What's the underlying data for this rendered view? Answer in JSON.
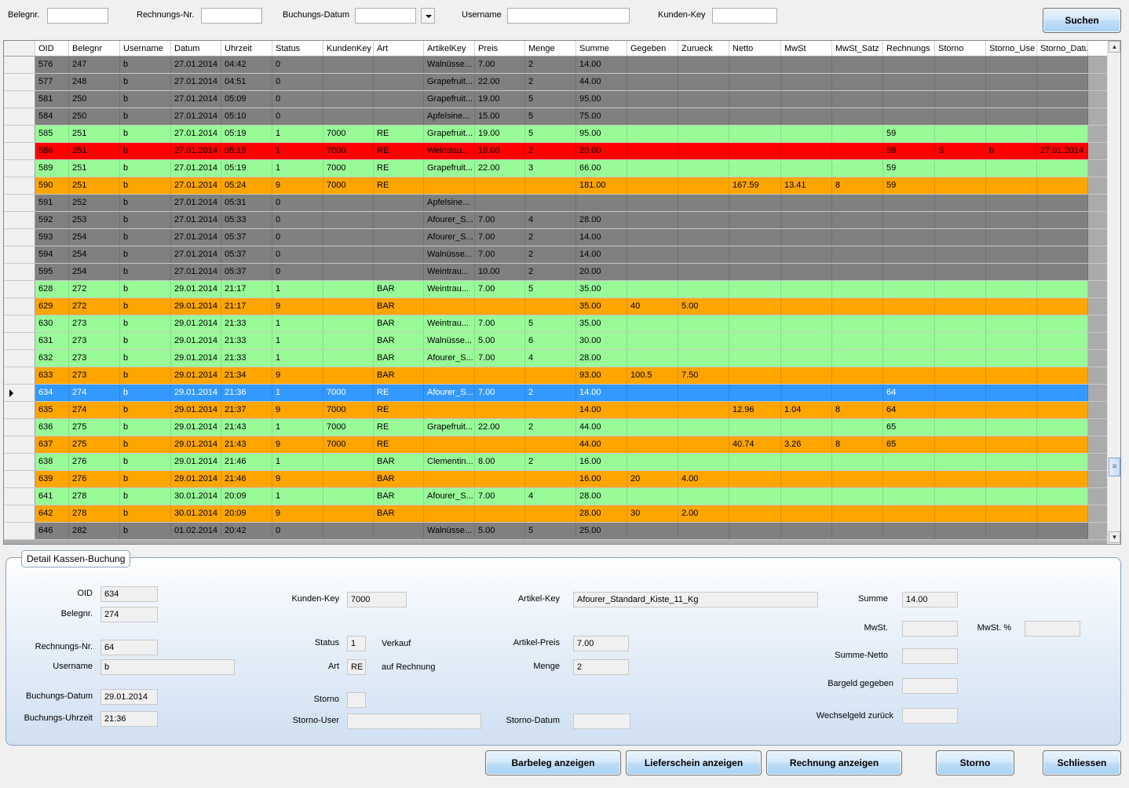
{
  "search": {
    "belegnr_label": "Belegnr.",
    "belegnr_value": "",
    "rechnungsnr_label": "Rechnungs-Nr.",
    "rechnungsnr_value": "",
    "buchungsdatum_label": "Buchungs-Datum",
    "buchungsdatum_value": "",
    "username_label": "Username",
    "username_value": "",
    "kundenkey_label": "Kunden-Key",
    "kundenkey_value": "",
    "search_button": "Suchen"
  },
  "grid": {
    "columns": [
      "OID",
      "Belegnr",
      "Username",
      "Datum",
      "Uhrzeit",
      "Status",
      "KundenKey",
      "Art",
      "ArtikelKey",
      "Preis",
      "Menge",
      "Summe",
      "Gegeben",
      "Zurueck",
      "Netto",
      "MwSt",
      "MwSt_Satz",
      "Rechnungs",
      "Storno",
      "Storno_Use",
      "Storno_Datu"
    ],
    "status_colors": {
      "gray": "#808080",
      "green": "#98fb98",
      "red": "#ff0000",
      "orange": "#ffa500",
      "selected": "#3399ff"
    },
    "rows": [
      {
        "style": "gray",
        "cells": [
          "576",
          "247",
          "b",
          "27.01.2014",
          "04:42",
          "0",
          "",
          "",
          "Walnüsse...",
          "7.00",
          "2",
          "14.00",
          "",
          "",
          "",
          "",
          "",
          "",
          "",
          "",
          ""
        ]
      },
      {
        "style": "gray",
        "cells": [
          "577",
          "248",
          "b",
          "27.01.2014",
          "04:51",
          "0",
          "",
          "",
          "Grapefruit...",
          "22.00",
          "2",
          "44.00",
          "",
          "",
          "",
          "",
          "",
          "",
          "",
          "",
          ""
        ]
      },
      {
        "style": "gray",
        "cells": [
          "581",
          "250",
          "b",
          "27.01.2014",
          "05:09",
          "0",
          "",
          "",
          "Grapefruit...",
          "19.00",
          "5",
          "95.00",
          "",
          "",
          "",
          "",
          "",
          "",
          "",
          "",
          ""
        ]
      },
      {
        "style": "gray",
        "cells": [
          "584",
          "250",
          "b",
          "27.01.2014",
          "05:10",
          "0",
          "",
          "",
          "Apfelsine...",
          "15.00",
          "5",
          "75.00",
          "",
          "",
          "",
          "",
          "",
          "",
          "",
          "",
          ""
        ]
      },
      {
        "style": "green",
        "cells": [
          "585",
          "251",
          "b",
          "27.01.2014",
          "05:19",
          "1",
          "7000",
          "RE",
          "Grapefruit...",
          "19.00",
          "5",
          "95.00",
          "",
          "",
          "",
          "",
          "",
          "59",
          "",
          "",
          ""
        ]
      },
      {
        "style": "red",
        "cells": [
          "586",
          "251",
          "b",
          "27.01.2014",
          "05:19",
          "1",
          "7000",
          "RE",
          "Weintrau...",
          "10.00",
          "2",
          "20.00",
          "",
          "",
          "",
          "",
          "",
          "59",
          "S",
          "b",
          "27.01.2014"
        ]
      },
      {
        "style": "green",
        "cells": [
          "589",
          "251",
          "b",
          "27.01.2014",
          "05:19",
          "1",
          "7000",
          "RE",
          "Grapefruit...",
          "22.00",
          "3",
          "66.00",
          "",
          "",
          "",
          "",
          "",
          "59",
          "",
          "",
          ""
        ]
      },
      {
        "style": "orange",
        "cells": [
          "590",
          "251",
          "b",
          "27.01.2014",
          "05:24",
          "9",
          "7000",
          "RE",
          "",
          "",
          "",
          "181.00",
          "",
          "",
          "167.59",
          "13.41",
          "8",
          "59",
          "",
          "",
          ""
        ]
      },
      {
        "style": "gray",
        "cells": [
          "591",
          "252",
          "b",
          "27.01.2014",
          "05:31",
          "0",
          "",
          "",
          "Apfelsine...",
          "",
          "",
          "",
          "",
          "",
          "",
          "",
          "",
          "",
          "",
          "",
          ""
        ]
      },
      {
        "style": "gray",
        "cells": [
          "592",
          "253",
          "b",
          "27.01.2014",
          "05:33",
          "0",
          "",
          "",
          "Afourer_S...",
          "7.00",
          "4",
          "28.00",
          "",
          "",
          "",
          "",
          "",
          "",
          "",
          "",
          ""
        ]
      },
      {
        "style": "gray",
        "cells": [
          "593",
          "254",
          "b",
          "27.01.2014",
          "05:37",
          "0",
          "",
          "",
          "Afourer_S...",
          "7.00",
          "2",
          "14.00",
          "",
          "",
          "",
          "",
          "",
          "",
          "",
          "",
          ""
        ]
      },
      {
        "style": "gray",
        "cells": [
          "594",
          "254",
          "b",
          "27.01.2014",
          "05:37",
          "0",
          "",
          "",
          "Walnüsse...",
          "7.00",
          "2",
          "14.00",
          "",
          "",
          "",
          "",
          "",
          "",
          "",
          "",
          ""
        ]
      },
      {
        "style": "gray",
        "cells": [
          "595",
          "254",
          "b",
          "27.01.2014",
          "05:37",
          "0",
          "",
          "",
          "Weintrau...",
          "10.00",
          "2",
          "20.00",
          "",
          "",
          "",
          "",
          "",
          "",
          "",
          "",
          ""
        ]
      },
      {
        "style": "green",
        "cells": [
          "628",
          "272",
          "b",
          "29.01.2014",
          "21:17",
          "1",
          "",
          "BAR",
          "Weintrau...",
          "7.00",
          "5",
          "35.00",
          "",
          "",
          "",
          "",
          "",
          "",
          "",
          "",
          ""
        ]
      },
      {
        "style": "orange",
        "cells": [
          "629",
          "272",
          "b",
          "29.01.2014",
          "21:17",
          "9",
          "",
          "BAR",
          "",
          "",
          "",
          "35.00",
          "40",
          "5.00",
          "",
          "",
          "",
          "",
          "",
          "",
          ""
        ]
      },
      {
        "style": "green",
        "cells": [
          "630",
          "273",
          "b",
          "29.01.2014",
          "21:33",
          "1",
          "",
          "BAR",
          "Weintrau...",
          "7.00",
          "5",
          "35.00",
          "",
          "",
          "",
          "",
          "",
          "",
          "",
          "",
          ""
        ]
      },
      {
        "style": "green",
        "cells": [
          "631",
          "273",
          "b",
          "29.01.2014",
          "21:33",
          "1",
          "",
          "BAR",
          "Walnüsse...",
          "5.00",
          "6",
          "30.00",
          "",
          "",
          "",
          "",
          "",
          "",
          "",
          "",
          ""
        ]
      },
      {
        "style": "green",
        "cells": [
          "632",
          "273",
          "b",
          "29.01.2014",
          "21:33",
          "1",
          "",
          "BAR",
          "Afourer_S...",
          "7.00",
          "4",
          "28.00",
          "",
          "",
          "",
          "",
          "",
          "",
          "",
          "",
          ""
        ]
      },
      {
        "style": "orange",
        "cells": [
          "633",
          "273",
          "b",
          "29.01.2014",
          "21:34",
          "9",
          "",
          "BAR",
          "",
          "",
          "",
          "93.00",
          "100.5",
          "7.50",
          "",
          "",
          "",
          "",
          "",
          "",
          ""
        ]
      },
      {
        "style": "blue",
        "current": true,
        "cells": [
          "634",
          "274",
          "b",
          "29.01.2014",
          "21:36",
          "1",
          "7000",
          "RE",
          "Afourer_S...",
          "7.00",
          "2",
          "14.00",
          "",
          "",
          "",
          "",
          "",
          "64",
          "",
          "",
          ""
        ]
      },
      {
        "style": "orange",
        "cells": [
          "635",
          "274",
          "b",
          "29.01.2014",
          "21:37",
          "9",
          "7000",
          "RE",
          "",
          "",
          "",
          "14.00",
          "",
          "",
          "12.96",
          "1.04",
          "8",
          "64",
          "",
          "",
          ""
        ]
      },
      {
        "style": "green",
        "cells": [
          "636",
          "275",
          "b",
          "29.01.2014",
          "21:43",
          "1",
          "7000",
          "RE",
          "Grapefruit...",
          "22.00",
          "2",
          "44.00",
          "",
          "",
          "",
          "",
          "",
          "65",
          "",
          "",
          ""
        ]
      },
      {
        "style": "orange",
        "cells": [
          "637",
          "275",
          "b",
          "29.01.2014",
          "21:43",
          "9",
          "7000",
          "RE",
          "",
          "",
          "",
          "44.00",
          "",
          "",
          "40.74",
          "3.26",
          "8",
          "65",
          "",
          "",
          ""
        ]
      },
      {
        "style": "green",
        "cells": [
          "638",
          "276",
          "b",
          "29.01.2014",
          "21:46",
          "1",
          "",
          "BAR",
          "Clementin...",
          "8.00",
          "2",
          "16.00",
          "",
          "",
          "",
          "",
          "",
          "",
          "",
          "",
          ""
        ]
      },
      {
        "style": "orange",
        "cells": [
          "639",
          "276",
          "b",
          "29.01.2014",
          "21:46",
          "9",
          "",
          "BAR",
          "",
          "",
          "",
          "16.00",
          "20",
          "4.00",
          "",
          "",
          "",
          "",
          "",
          "",
          ""
        ]
      },
      {
        "style": "green",
        "cells": [
          "641",
          "278",
          "b",
          "30.01.2014",
          "20:09",
          "1",
          "",
          "BAR",
          "Afourer_S...",
          "7.00",
          "4",
          "28.00",
          "",
          "",
          "",
          "",
          "",
          "",
          "",
          "",
          ""
        ]
      },
      {
        "style": "orange",
        "cells": [
          "642",
          "278",
          "b",
          "30.01.2014",
          "20:09",
          "9",
          "",
          "BAR",
          "",
          "",
          "",
          "28.00",
          "30",
          "2.00",
          "",
          "",
          "",
          "",
          "",
          "",
          ""
        ]
      },
      {
        "style": "gray",
        "cells": [
          "646",
          "282",
          "b",
          "01.02.2014",
          "20:42",
          "0",
          "",
          "",
          "Walnüsse...",
          "5.00",
          "5",
          "25.00",
          "",
          "",
          "",
          "",
          "",
          "",
          "",
          "",
          ""
        ]
      }
    ]
  },
  "detail": {
    "title": "Detail Kassen-Buchung",
    "oid_label": "OID",
    "oid_value": "634",
    "belegnr_label": "Belegnr.",
    "belegnr_value": "274",
    "rechnungsnr_label": "Rechnungs-Nr.",
    "rechnungsnr_value": "64",
    "username_label": "Username",
    "username_value": "b",
    "buchungsdatum_label": "Buchungs-Datum",
    "buchungsdatum_value": "29.01.2014",
    "buchungsuhrzeit_label": "Buchungs-Uhrzeit",
    "buchungsuhrzeit_value": "21:36",
    "kundenkey_label": "Kunden-Key",
    "kundenkey_value": "7000",
    "status_label": "Status",
    "status_value": "1",
    "status_text": "Verkauf",
    "art_label": "Art",
    "art_value": "RE",
    "art_text": "auf Rechnung",
    "storno_label": "Storno",
    "storno_value": "",
    "stornouser_label": "Storno-User",
    "stornouser_value": "",
    "artikelkey_label": "Artikel-Key",
    "artikelkey_value": "Afourer_Standard_Kiste_11_Kg",
    "artikelpreis_label": "Artikel-Preis",
    "artikelpreis_value": "7.00",
    "menge_label": "Menge",
    "menge_value": "2",
    "stornodatum_label": "Storno-Datum",
    "stornodatum_value": "",
    "summe_label": "Summe",
    "summe_value": "14.00",
    "mwst_label": "MwSt.",
    "mwst_value": "",
    "mwst_pct_label": "MwSt. %",
    "mwst_pct_value": "",
    "summenetto_label": "Summe-Netto",
    "summenetto_value": "",
    "bargeld_label": "Bargeld gegeben",
    "bargeld_value": "",
    "wechselgeld_label": "Wechselgeld zurück",
    "wechselgeld_value": ""
  },
  "buttons": {
    "barbeleg": "Barbeleg anzeigen",
    "lieferschein": "Lieferschein anzeigen",
    "rechnung": "Rechnung anzeigen",
    "storno": "Storno",
    "schliessen": "Schliessen"
  }
}
